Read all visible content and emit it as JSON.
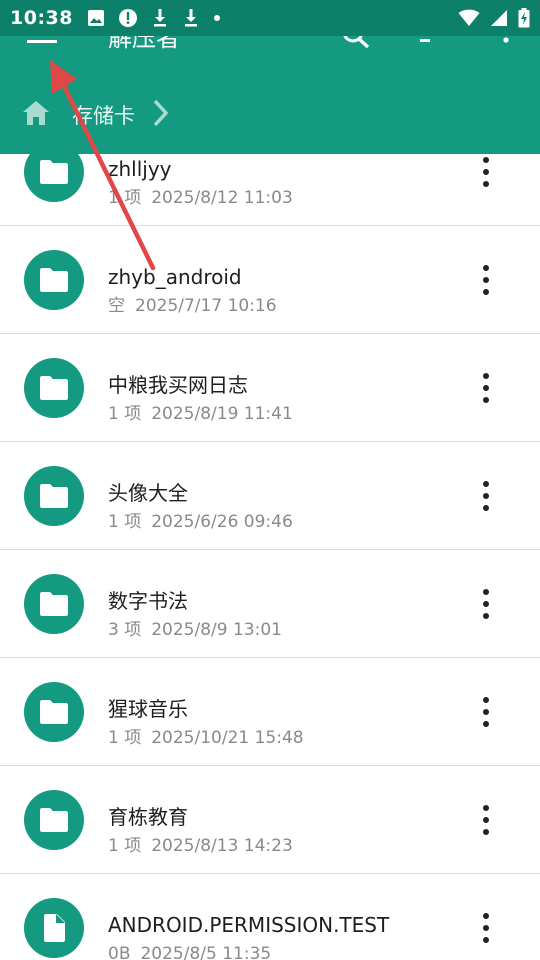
{
  "status_bar": {
    "time": "10:38",
    "left_icons": [
      "image-icon",
      "alert-icon",
      "download-icon",
      "download-icon",
      "dot-icon"
    ],
    "right_icons": [
      "wifi-icon",
      "signal-icon",
      "battery-charging-icon"
    ]
  },
  "app_bar": {
    "title": "解压者",
    "colors": {
      "status": "#0d8069",
      "toolbar": "#139a80",
      "accent": "#139a80"
    }
  },
  "breadcrumb": {
    "root_icon": "home-icon",
    "items": [
      {
        "label": "存储卡"
      }
    ]
  },
  "files": [
    {
      "name": "zhlljyy",
      "count": "1 项",
      "date": "2025/8/12 11:03",
      "type": "folder"
    },
    {
      "name": "zhyb_android",
      "count": "空",
      "date": "2025/7/17 10:16",
      "type": "folder"
    },
    {
      "name": "中粮我买网日志",
      "count": "1 项",
      "date": "2025/8/19 11:41",
      "type": "folder"
    },
    {
      "name": "头像大全",
      "count": "1 项",
      "date": "2025/6/26 09:46",
      "type": "folder"
    },
    {
      "name": "数字书法",
      "count": "3 项",
      "date": "2025/8/9 13:01",
      "type": "folder"
    },
    {
      "name": "猩球音乐",
      "count": "1 项",
      "date": "2025/10/21 15:48",
      "type": "folder"
    },
    {
      "name": "育栋教育",
      "count": "1 项",
      "date": "2025/8/13 14:23",
      "type": "folder"
    },
    {
      "name": "ANDROID.PERMISSION.TEST",
      "count": "0B",
      "date": "2025/8/5 11:35",
      "type": "file"
    }
  ]
}
